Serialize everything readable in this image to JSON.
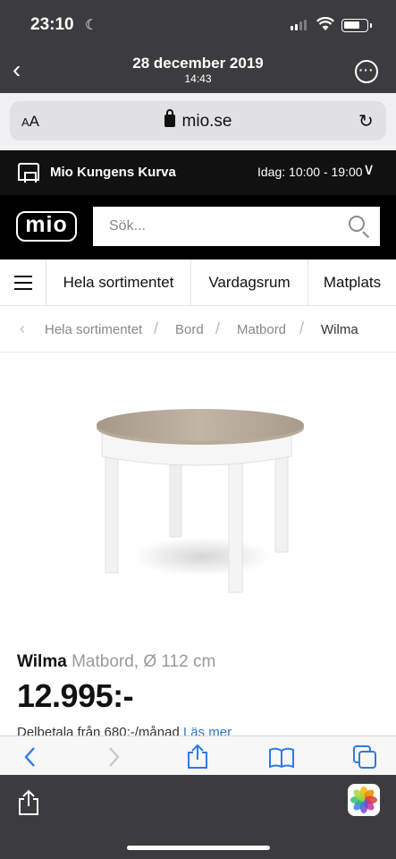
{
  "status": {
    "time": "23:10"
  },
  "photo_viewer": {
    "date": "28 december 2019",
    "time": "14:43"
  },
  "browser": {
    "text_size": "AA",
    "domain": "mio.se"
  },
  "store": {
    "name": "Mio Kungens Kurva",
    "hours": "Idag: 10:00 - 19:00"
  },
  "header": {
    "logo": "mio",
    "search_placeholder": "Sök..."
  },
  "nav": {
    "items": [
      "Hela sortimentet",
      "Vardagsrum",
      "Matplats"
    ]
  },
  "breadcrumb": [
    "Hela sortimentet",
    "Bord",
    "Matbord",
    "Wilma"
  ],
  "product": {
    "name": "Wilma",
    "subtitle": "Matbord, Ø 112 cm",
    "price": "12.995:-",
    "installment": "Delbetala från 680:-/månad",
    "read_more": "Läs mer"
  },
  "colors": {
    "accent": "#2f7ae5",
    "header_bg": "#000000",
    "store_bg": "#111111"
  }
}
